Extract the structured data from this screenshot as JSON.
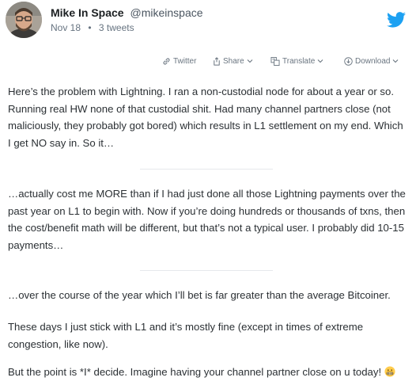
{
  "author": {
    "display_name": "Mike In Space",
    "handle": "@mikeinspace",
    "date": "Nov 18",
    "separator": "•",
    "tweet_count": "3 tweets"
  },
  "actions": {
    "twitter": "Twitter",
    "share": "Share",
    "translate": "Translate",
    "download": "Download"
  },
  "tweets": [
    "Here’s the problem with Lightning. I ran a non-custodial node for about a year or so. Running real HW none of that custodial shit. Had many channel partners close (not maliciously, they probably got bored) which results in L1 settlement on my end. Which I get NO say in. So it…",
    "…actually cost me MORE than if I had just done all those Lightning payments over the past year on L1 to begin with. Now if you’re doing hundreds or thousands of txns, then the cost/benefit math will be different, but that’s not a typical user. I probably did 10-15 payments…",
    "…over the course of the year which I’ll bet is far greater than the average Bitcoiner.",
    "These days I just stick with L1 and it’s mostly fine (except in times of extreme congestion, like now).",
    "But the point is *I* decide. Imagine having your channel partner close on u today!"
  ],
  "icons": {
    "avatar": "profile-photo",
    "logo": "twitter-bird-icon",
    "emoji": "grimacing-face-emoji"
  },
  "colors": {
    "twitter_blue": "#1da1f2",
    "text": "#2b3034",
    "muted": "#667380"
  }
}
